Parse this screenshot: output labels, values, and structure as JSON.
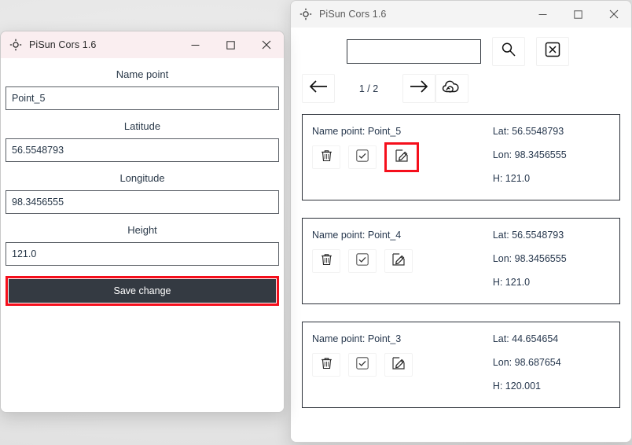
{
  "left_window": {
    "title": "PiSun Cors 1.6",
    "app_icon": "crosshair-target-icon",
    "caption": {
      "minimize": "minimize-icon",
      "maximize": "maximize-icon",
      "close": "close-icon"
    },
    "fields": [
      {
        "label": "Name point",
        "value": "Point_5",
        "name": "name-point"
      },
      {
        "label": "Latitude",
        "value": "56.5548793",
        "name": "latitude"
      },
      {
        "label": "Longitude",
        "value": "98.3456555",
        "name": "longitude"
      },
      {
        "label": "Height",
        "value": "121.0",
        "name": "height"
      }
    ],
    "save_button": {
      "label": "Save change",
      "highlighted": true,
      "highlight_color": "#f50f1c",
      "background": "#343a42",
      "text_color": "#ffffff"
    }
  },
  "right_window": {
    "title": "PiSun Cors 1.6",
    "app_icon": "crosshair-target-icon",
    "caption": {
      "minimize": "minimize-icon",
      "maximize": "maximize-icon",
      "close": "close-icon"
    },
    "toolbar": {
      "search_value": "",
      "search_placeholder": "",
      "search_button": "search-icon",
      "clear_button": "boxed-x-icon"
    },
    "navigation": {
      "prev_button": "arrow-left-icon",
      "page_indicator": "1 / 2",
      "next_button": "arrow-right-icon",
      "sync_button": "cloud-sync-icon"
    },
    "cards": [
      {
        "name_label": "Name point: Point_5",
        "lat": "Lat: 56.5548793",
        "lon": "Lon: 98.3456555",
        "h": "H: 121.0",
        "actions": {
          "delete": "trash-icon",
          "confirm": "checkbox-check-icon",
          "edit": "pencil-edit-icon"
        },
        "edit_highlighted": true
      },
      {
        "name_label": "Name point: Point_4",
        "lat": "Lat: 56.5548793",
        "lon": "Lon: 98.3456555",
        "h": "H: 121.0",
        "actions": {
          "delete": "trash-icon",
          "confirm": "checkbox-check-icon",
          "edit": "pencil-edit-icon"
        },
        "edit_highlighted": false
      },
      {
        "name_label": "Name point: Point_3",
        "lat": "Lat: 44.654654",
        "lon": "Lon: 98.687654",
        "h": "H: 120.001",
        "actions": {
          "delete": "trash-icon",
          "confirm": "checkbox-check-icon",
          "edit": "pencil-edit-icon"
        },
        "edit_highlighted": false
      }
    ]
  },
  "colors": {
    "left_titlebar": "#faeef0",
    "right_titlebar": "#f4f4f4",
    "accent_highlight": "#f50f1c",
    "button_dark": "#343a42",
    "text_primary": "#26374d",
    "desktop": "#e9e9e9"
  }
}
